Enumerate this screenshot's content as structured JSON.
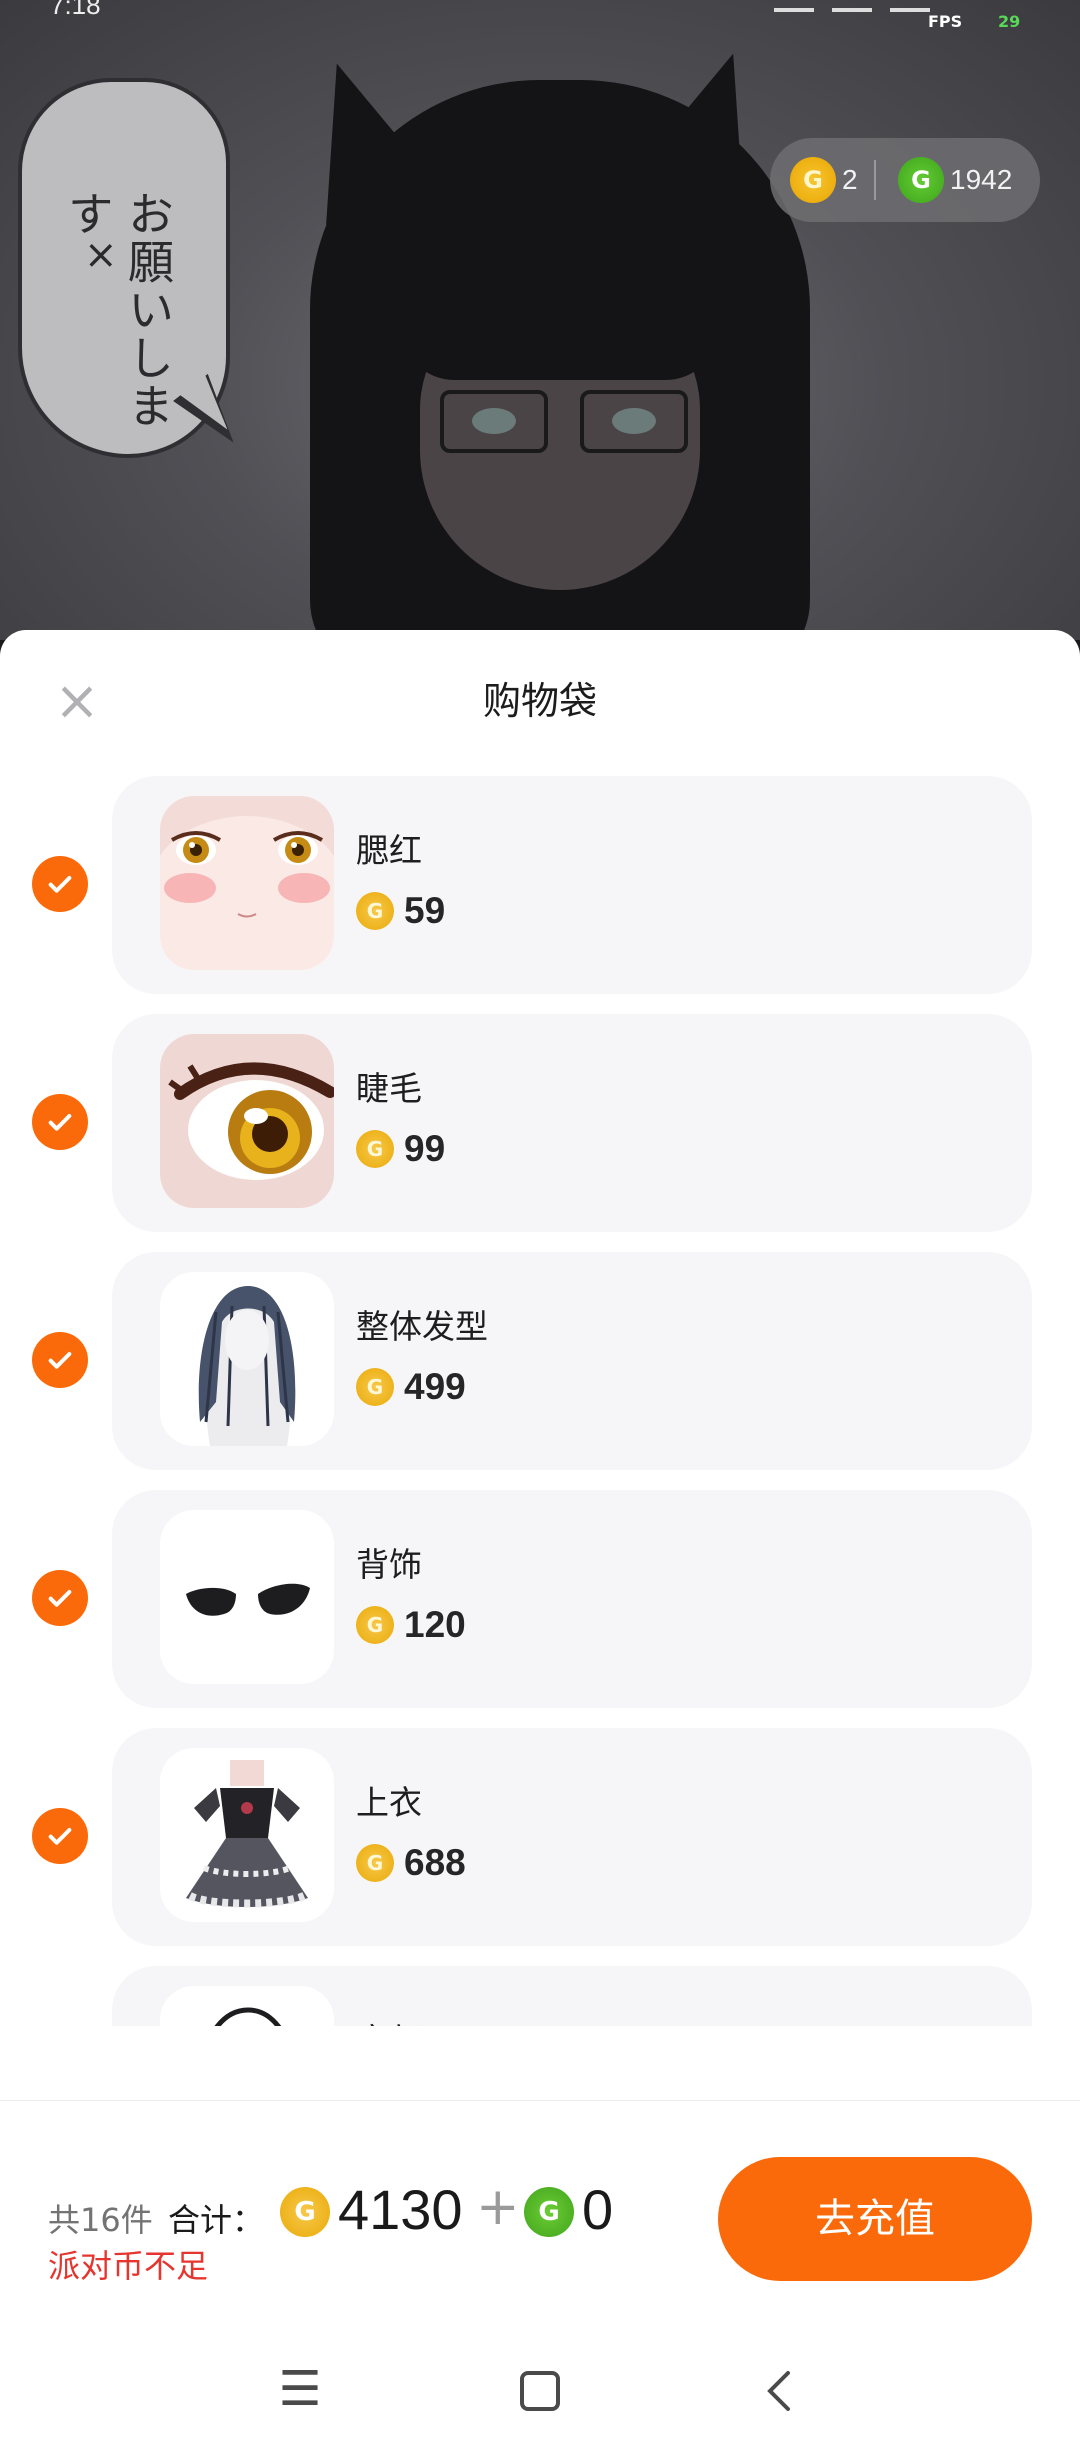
{
  "status_bar": {
    "time": "7:18",
    "fps_label": "FPS",
    "fps_value": "29"
  },
  "background": {
    "speech_bubble_text": "お願いします",
    "close_mark": "×"
  },
  "currency": {
    "gold_coins": "2",
    "green_coins": "1942",
    "gold_icon": "gold-coin-icon",
    "green_icon": "green-coin-icon"
  },
  "sheet": {
    "title": "购物袋",
    "close_icon": "close-icon"
  },
  "items": [
    {
      "name": "腮红",
      "price": "59",
      "checked": true
    },
    {
      "name": "睫毛",
      "price": "99",
      "checked": true
    },
    {
      "name": "整体发型",
      "price": "499",
      "checked": true
    },
    {
      "name": "背饰",
      "price": "120",
      "checked": true
    },
    {
      "name": "上衣",
      "price": "688",
      "checked": true
    },
    {
      "name": "肩部",
      "price": "",
      "checked": true
    }
  ],
  "footer": {
    "count_text": "共16件",
    "total_label": "合计：",
    "gold_total": "4130",
    "plus": "+",
    "green_total": "0",
    "warning": "派对币不足",
    "recharge_label": "去充值"
  },
  "colors": {
    "accent": "#fb6a0a",
    "warning": "#e5352e",
    "gold": "#eaaa08",
    "green": "#41a41c"
  }
}
